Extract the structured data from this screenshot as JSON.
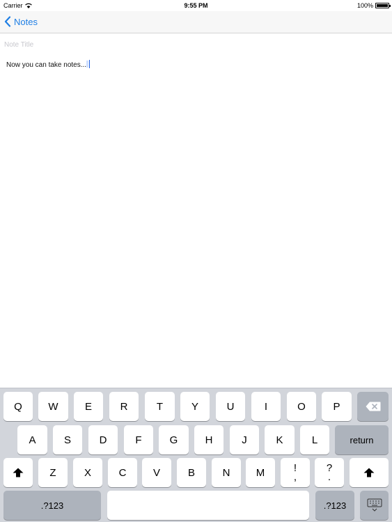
{
  "status_bar": {
    "carrier": "Carrier",
    "time": "9:55 PM",
    "battery": "100%",
    "battery_level": 1.0
  },
  "nav": {
    "back_label": "Notes"
  },
  "note": {
    "title_placeholder": "Note Title",
    "title_value": "",
    "body": "Now you can take notes...."
  },
  "keyboard": {
    "row1": [
      "Q",
      "W",
      "E",
      "R",
      "T",
      "Y",
      "U",
      "I",
      "O",
      "P"
    ],
    "row2": [
      "A",
      "S",
      "D",
      "F",
      "G",
      "H",
      "J",
      "K",
      "L"
    ],
    "row3": [
      "Z",
      "X",
      "C",
      "V",
      "B",
      "N",
      "M"
    ],
    "return_label": "return",
    "numbers_label": ".?123",
    "punct1": {
      "top": "!",
      "bottom": ","
    },
    "punct2": {
      "top": "?",
      "bottom": "."
    },
    "icons": {
      "backspace": "backspace-icon",
      "shift": "shift-icon",
      "dismiss": "keyboard-dismiss-icon"
    }
  }
}
